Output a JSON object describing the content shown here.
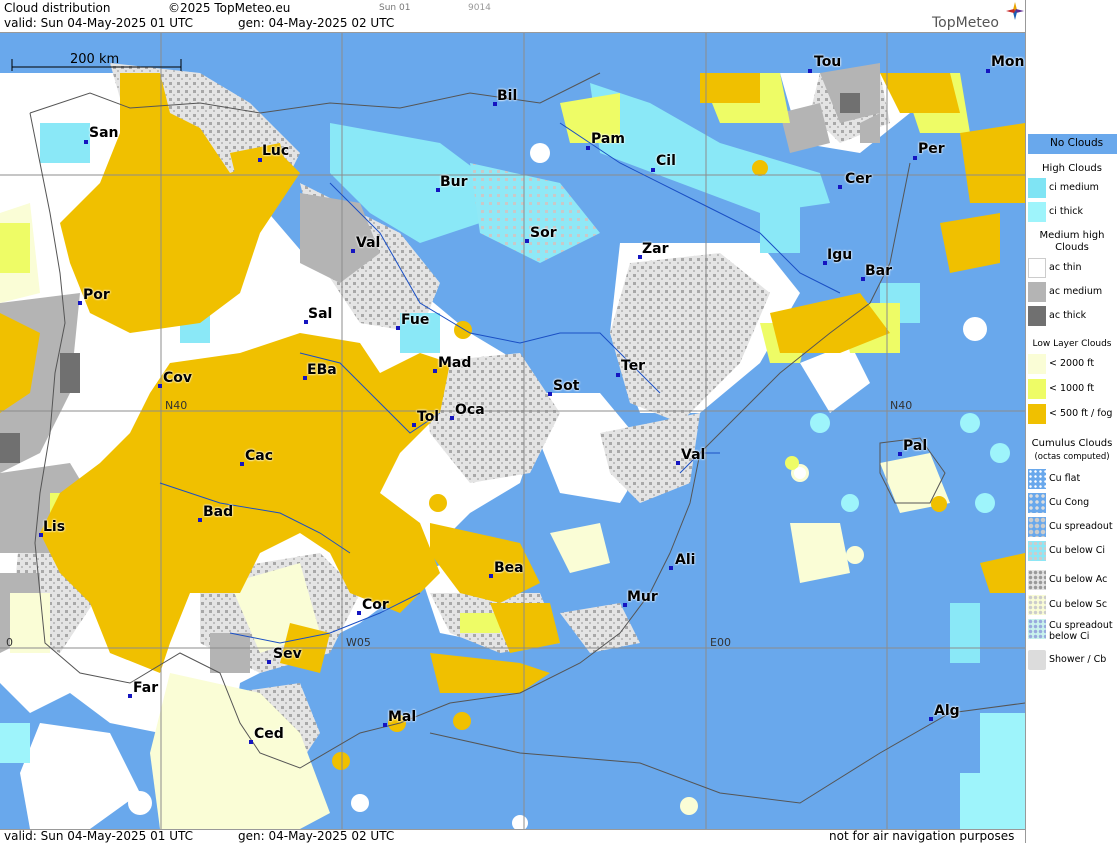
{
  "header": {
    "title": "Cloud distribution",
    "copyright": "©2025 TopMeteo.eu",
    "valid": "valid:  Sun  04-May-2025  01 UTC",
    "gen": "gen: 04-May-2025 02 UTC",
    "small_day": "Sun 01",
    "small_code": "9014",
    "logo": "TopMeteo"
  },
  "footer": {
    "valid": "valid:  Sun  04-May-2025  01 UTC",
    "gen": "gen: 04-May-2025 02 UTC",
    "disclaimer": "not for air navigation purposes"
  },
  "map": {
    "scale_label": "200 km",
    "grid_labels": [
      "N40",
      "N40",
      "W05",
      "E00",
      "0"
    ],
    "cities": [
      "Bil",
      "Tou",
      "Mon",
      "San",
      "Pam",
      "Luc",
      "Cil",
      "Per",
      "Bur",
      "Cer",
      "Sor",
      "Val",
      "Zar",
      "Igu",
      "Bar",
      "Por",
      "Sal",
      "Fue",
      "Mad",
      "Ter",
      "Cov",
      "EBa",
      "Sot",
      "Tol",
      "Oca",
      "Pal",
      "Cac",
      "Val",
      "Bad",
      "Lis",
      "Ali",
      "Bea",
      "Mur",
      "Cor",
      "Sev",
      "Far",
      "Mal",
      "Alg",
      "Ced"
    ]
  },
  "legend": {
    "no_clouds": "No Clouds",
    "high_head": "High Clouds",
    "ci_medium": "ci medium",
    "ci_thick": "ci thick",
    "medium_head": "Medium high Clouds",
    "ac_thin": "ac thin",
    "ac_medium": "ac medium",
    "ac_thick": "ac thick",
    "low_head": "Low Layer Clouds",
    "low1": "< 2000 ft",
    "low2": "< 1000 ft",
    "low3": "< 500 ft / fog",
    "cu_head": "Cumulus Clouds",
    "cu_sub": "(octas computed)",
    "cu_flat": "Cu flat",
    "cu_cong": "Cu Cong",
    "cu_spreadout": "Cu spreadout",
    "cu_below_ci": "Cu below Ci",
    "cu_below_ac": "Cu below Ac",
    "cu_below_sc": "Cu below Sc",
    "cu_spread_ci": "Cu spreadout below Ci",
    "shower": "Shower / Cb"
  },
  "colors": {
    "no_clouds": "#69a8ec",
    "ci_medium": "#7fe4f4",
    "ci_thick": "#9ef4fb",
    "ac_thin": "#ffffff",
    "ac_medium": "#b4b4b4",
    "ac_thick": "#707070",
    "low1": "#fafdd6",
    "low2": "#eefc66",
    "low3": "#f0c000"
  }
}
